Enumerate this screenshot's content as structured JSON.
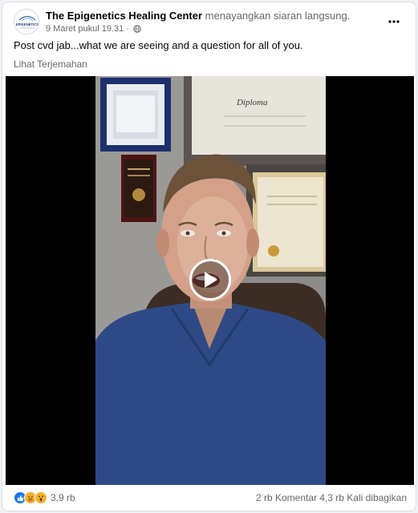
{
  "post": {
    "page_name": "The Epigenetics Healing Center",
    "action_text": "menayangkan siaran langsung.",
    "timestamp": "9 Maret pukul 19.31",
    "separator": "·",
    "privacy_icon": "globe-icon",
    "avatar_text": "EPIGENETICS",
    "text": "Post cvd jab...what we are seeing and a question for all of you.",
    "translate_label": "Lihat Terjemahan"
  },
  "video": {
    "play_icon": "play-icon",
    "diploma_text": "Diploma"
  },
  "footer": {
    "reactions": [
      "like",
      "care",
      "wow"
    ],
    "reaction_count": "3,9 rb",
    "comments": "2 rb Komentar",
    "shares": "4,3 rb Kali dibagikan"
  },
  "colors": {
    "name": "#050505",
    "secondary": "#65676b",
    "like_blue": "#1877f2",
    "wow_yellow": "#f7b125",
    "scrubs": "#2e4a86"
  }
}
